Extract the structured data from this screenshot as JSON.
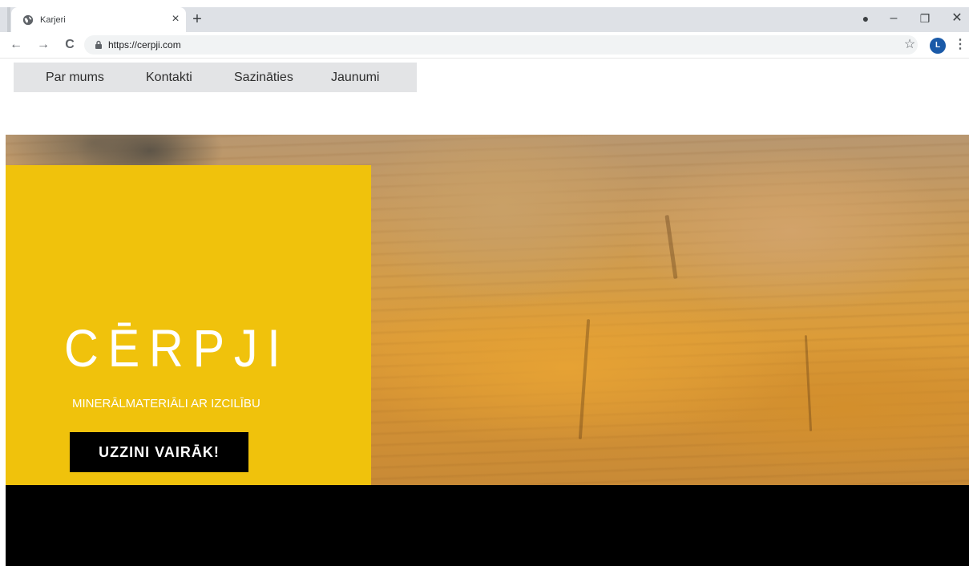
{
  "browser": {
    "tab": {
      "title": "Karjeri",
      "close": "×"
    },
    "new_tab": "+",
    "window_controls": {
      "profile": "●",
      "minimize": "–",
      "restore": "❐",
      "close": "✕"
    },
    "nav": {
      "back": "←",
      "forward": "→",
      "reload": "C"
    },
    "address": {
      "url": "https://cerpji.com"
    },
    "bookmark_star": "☆",
    "profile_initial": "L",
    "menu": "⋮"
  },
  "site": {
    "nav": [
      "Par mums",
      "Kontakti",
      "Sazināties",
      "Jaunumi"
    ],
    "hero": {
      "brand": "CĒRPJI",
      "tagline": "MINERĀLMATERIĀLI AR IZCILĪBU",
      "cta": "UZZINI VAIRĀK!"
    }
  },
  "colors": {
    "panel": "#f0c20c",
    "cta_bg": "#000000",
    "nav_bg": "#e3e4e6",
    "tabstrip": "#dee1e6"
  }
}
